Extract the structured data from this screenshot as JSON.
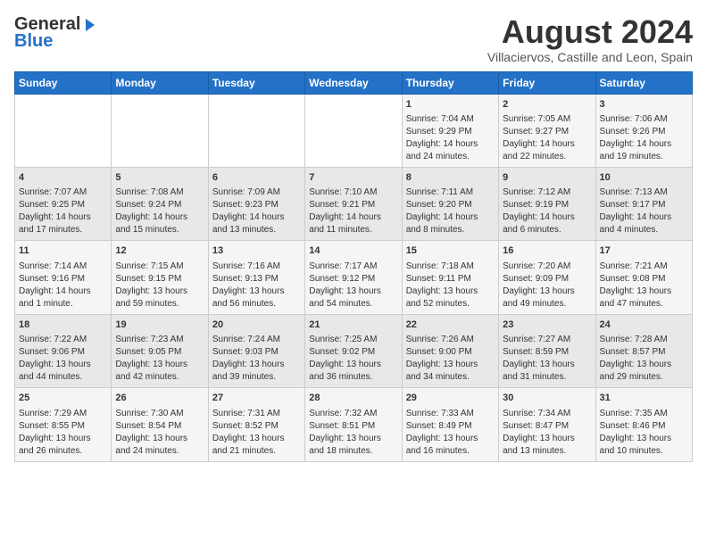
{
  "header": {
    "logo_general": "General",
    "logo_blue": "Blue",
    "month_title": "August 2024",
    "subtitle": "Villaciervos, Castille and Leon, Spain"
  },
  "weekdays": [
    "Sunday",
    "Monday",
    "Tuesday",
    "Wednesday",
    "Thursday",
    "Friday",
    "Saturday"
  ],
  "weeks": [
    [
      {
        "day": "",
        "info": ""
      },
      {
        "day": "",
        "info": ""
      },
      {
        "day": "",
        "info": ""
      },
      {
        "day": "",
        "info": ""
      },
      {
        "day": "1",
        "info": "Sunrise: 7:04 AM\nSunset: 9:29 PM\nDaylight: 14 hours and 24 minutes."
      },
      {
        "day": "2",
        "info": "Sunrise: 7:05 AM\nSunset: 9:27 PM\nDaylight: 14 hours and 22 minutes."
      },
      {
        "day": "3",
        "info": "Sunrise: 7:06 AM\nSunset: 9:26 PM\nDaylight: 14 hours and 19 minutes."
      }
    ],
    [
      {
        "day": "4",
        "info": "Sunrise: 7:07 AM\nSunset: 9:25 PM\nDaylight: 14 hours and 17 minutes."
      },
      {
        "day": "5",
        "info": "Sunrise: 7:08 AM\nSunset: 9:24 PM\nDaylight: 14 hours and 15 minutes."
      },
      {
        "day": "6",
        "info": "Sunrise: 7:09 AM\nSunset: 9:23 PM\nDaylight: 14 hours and 13 minutes."
      },
      {
        "day": "7",
        "info": "Sunrise: 7:10 AM\nSunset: 9:21 PM\nDaylight: 14 hours and 11 minutes."
      },
      {
        "day": "8",
        "info": "Sunrise: 7:11 AM\nSunset: 9:20 PM\nDaylight: 14 hours and 8 minutes."
      },
      {
        "day": "9",
        "info": "Sunrise: 7:12 AM\nSunset: 9:19 PM\nDaylight: 14 hours and 6 minutes."
      },
      {
        "day": "10",
        "info": "Sunrise: 7:13 AM\nSunset: 9:17 PM\nDaylight: 14 hours and 4 minutes."
      }
    ],
    [
      {
        "day": "11",
        "info": "Sunrise: 7:14 AM\nSunset: 9:16 PM\nDaylight: 14 hours and 1 minute."
      },
      {
        "day": "12",
        "info": "Sunrise: 7:15 AM\nSunset: 9:15 PM\nDaylight: 13 hours and 59 minutes."
      },
      {
        "day": "13",
        "info": "Sunrise: 7:16 AM\nSunset: 9:13 PM\nDaylight: 13 hours and 56 minutes."
      },
      {
        "day": "14",
        "info": "Sunrise: 7:17 AM\nSunset: 9:12 PM\nDaylight: 13 hours and 54 minutes."
      },
      {
        "day": "15",
        "info": "Sunrise: 7:18 AM\nSunset: 9:11 PM\nDaylight: 13 hours and 52 minutes."
      },
      {
        "day": "16",
        "info": "Sunrise: 7:20 AM\nSunset: 9:09 PM\nDaylight: 13 hours and 49 minutes."
      },
      {
        "day": "17",
        "info": "Sunrise: 7:21 AM\nSunset: 9:08 PM\nDaylight: 13 hours and 47 minutes."
      }
    ],
    [
      {
        "day": "18",
        "info": "Sunrise: 7:22 AM\nSunset: 9:06 PM\nDaylight: 13 hours and 44 minutes."
      },
      {
        "day": "19",
        "info": "Sunrise: 7:23 AM\nSunset: 9:05 PM\nDaylight: 13 hours and 42 minutes."
      },
      {
        "day": "20",
        "info": "Sunrise: 7:24 AM\nSunset: 9:03 PM\nDaylight: 13 hours and 39 minutes."
      },
      {
        "day": "21",
        "info": "Sunrise: 7:25 AM\nSunset: 9:02 PM\nDaylight: 13 hours and 36 minutes."
      },
      {
        "day": "22",
        "info": "Sunrise: 7:26 AM\nSunset: 9:00 PM\nDaylight: 13 hours and 34 minutes."
      },
      {
        "day": "23",
        "info": "Sunrise: 7:27 AM\nSunset: 8:59 PM\nDaylight: 13 hours and 31 minutes."
      },
      {
        "day": "24",
        "info": "Sunrise: 7:28 AM\nSunset: 8:57 PM\nDaylight: 13 hours and 29 minutes."
      }
    ],
    [
      {
        "day": "25",
        "info": "Sunrise: 7:29 AM\nSunset: 8:55 PM\nDaylight: 13 hours and 26 minutes."
      },
      {
        "day": "26",
        "info": "Sunrise: 7:30 AM\nSunset: 8:54 PM\nDaylight: 13 hours and 24 minutes."
      },
      {
        "day": "27",
        "info": "Sunrise: 7:31 AM\nSunset: 8:52 PM\nDaylight: 13 hours and 21 minutes."
      },
      {
        "day": "28",
        "info": "Sunrise: 7:32 AM\nSunset: 8:51 PM\nDaylight: 13 hours and 18 minutes."
      },
      {
        "day": "29",
        "info": "Sunrise: 7:33 AM\nSunset: 8:49 PM\nDaylight: 13 hours and 16 minutes."
      },
      {
        "day": "30",
        "info": "Sunrise: 7:34 AM\nSunset: 8:47 PM\nDaylight: 13 hours and 13 minutes."
      },
      {
        "day": "31",
        "info": "Sunrise: 7:35 AM\nSunset: 8:46 PM\nDaylight: 13 hours and 10 minutes."
      }
    ]
  ]
}
